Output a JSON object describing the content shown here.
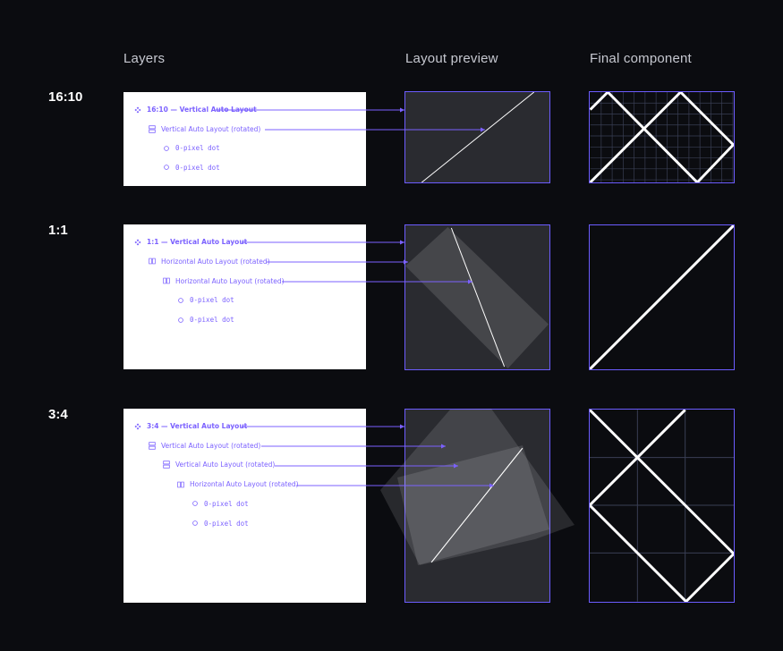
{
  "headers": {
    "layers": "Layers",
    "preview": "Layout preview",
    "final": "Final component"
  },
  "rows": [
    {
      "ratio": "16:10",
      "layers": [
        {
          "icon": "component-icon",
          "text": "16:10 — Vertical Auto Layout",
          "main": true
        },
        {
          "icon": "vertical-layout-icon",
          "text": "Vertical Auto Layout (rotated)"
        },
        {
          "icon": "dot-icon",
          "text": "0-pixel dot",
          "mono": true
        },
        {
          "icon": "dot-icon",
          "text": "0-pixel dot",
          "mono": true
        }
      ]
    },
    {
      "ratio": "1:1",
      "layers": [
        {
          "icon": "component-icon",
          "text": "1:1 — Vertical Auto Layout",
          "main": true
        },
        {
          "icon": "horizontal-layout-icon",
          "text": "Horizontal Auto Layout (rotated)"
        },
        {
          "icon": "horizontal-layout-icon",
          "text": "Horizontal Auto Layout (rotated)"
        },
        {
          "icon": "dot-icon",
          "text": "0-pixel dot",
          "mono": true
        },
        {
          "icon": "dot-icon",
          "text": "0-pixel dot",
          "mono": true
        }
      ]
    },
    {
      "ratio": "3:4",
      "layers": [
        {
          "icon": "component-icon",
          "text": "3:4 — Vertical Auto Layout",
          "main": true
        },
        {
          "icon": "vertical-layout-icon",
          "text": "Vertical Auto Layout (rotated)"
        },
        {
          "icon": "vertical-layout-icon",
          "text": "Vertical Auto Layout (rotated)"
        },
        {
          "icon": "horizontal-layout-icon",
          "text": "Horizontal Auto Layout (rotated)"
        },
        {
          "icon": "dot-icon",
          "text": "0-pixel dot",
          "mono": true
        },
        {
          "icon": "dot-icon",
          "text": "0-pixel dot",
          "mono": true
        }
      ]
    }
  ],
  "colors": {
    "accent": "#7b61ff",
    "border": "#6c5cff",
    "grid": "#3a3f55",
    "line": "#ffffff",
    "panel": "#ffffff",
    "background": "#0b0c10",
    "preview": "#2a2b30"
  }
}
